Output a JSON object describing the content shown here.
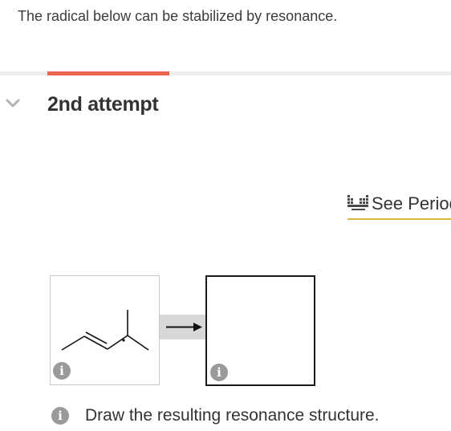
{
  "question": {
    "text": "The radical below can be stabilized by resonance."
  },
  "attempt": {
    "title": "2nd attempt",
    "toggle_icon": "chevron-down-icon"
  },
  "periodic_table": {
    "label": "See Periodic Table",
    "icon": "periodic-table-icon"
  },
  "reaction": {
    "start_info_icon": "info-icon",
    "arrow_icon": "reaction-arrow-icon",
    "drawing_info_icon": "info-icon",
    "info_glyph": "i"
  },
  "instruction": {
    "icon": "info-icon",
    "text": "Draw the resulting resonance structure."
  },
  "colors": {
    "progress_accent": "#e8674c",
    "link_underline": "#d9b53a",
    "icon_gray": "#9a9a9a",
    "text": "#333333"
  }
}
